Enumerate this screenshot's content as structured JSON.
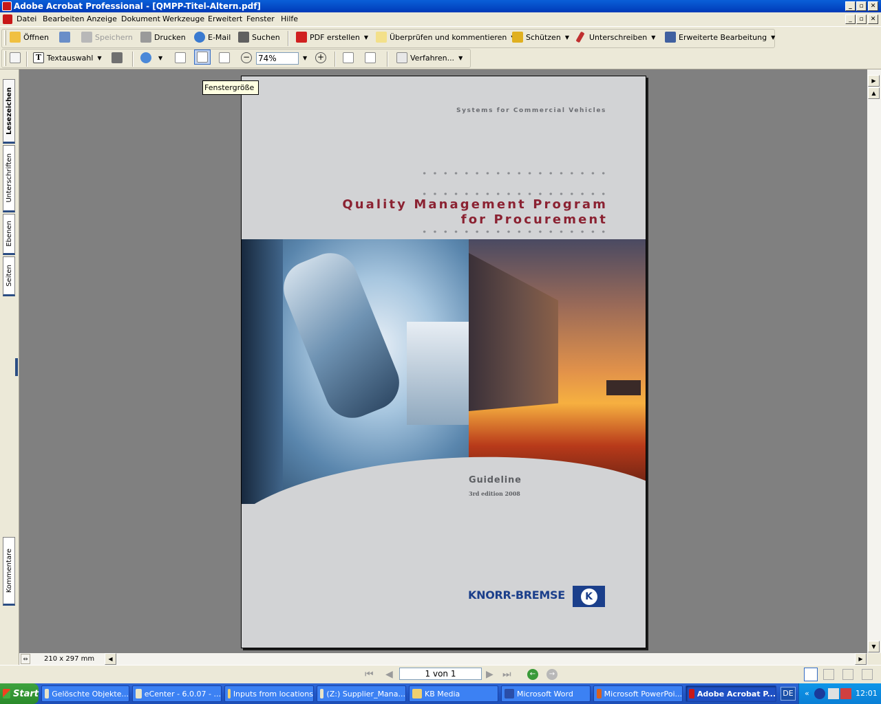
{
  "window": {
    "title": "Adobe Acrobat Professional - [QMPP-Titel-Altern.pdf]"
  },
  "menu": [
    "Datei",
    "Bearbeiten",
    "Anzeige",
    "Dokument",
    "Werkzeuge",
    "Erweitert",
    "Fenster",
    "Hilfe"
  ],
  "toolbar1": {
    "open": "Öffnen",
    "save": "Speichern",
    "print": "Drucken",
    "email": "E-Mail",
    "search": "Suchen",
    "create_pdf": "PDF erstellen",
    "review": "Überprüfen und kommentieren",
    "secure": "Schützen",
    "sign": "Unterschreiben",
    "advanced_edit": "Erweiterte Bearbeitung"
  },
  "toolbar2": {
    "text_select": "Textauswahl",
    "zoom": "74%",
    "procedures": "Verfahren..."
  },
  "tooltip": "Fenstergröße",
  "side_tabs": {
    "bookmarks": "Lesezeichen",
    "signatures": "Unterschriften",
    "layers": "Ebenen",
    "pages": "Seiten",
    "comments": "Kommentare"
  },
  "page_size": "210 x 297 mm",
  "page_indicator": "1 von 1",
  "document": {
    "tagline": "Systems for Commercial Vehicles",
    "title_line1": "Quality Management Program",
    "title_line2": "for Procurement",
    "subtitle": "Guideline",
    "edition": "3rd edition 2008",
    "brand": "KNORR-BREMSE",
    "brand_mark": "K"
  },
  "taskbar": {
    "start": "Start",
    "tasks": [
      "Gelöschte Objekte...",
      "eCenter - 6.0.07 - ...",
      "Inputs from locations",
      "(Z:) Supplier_Mana...",
      "KB Media",
      "Microsoft Word",
      "Microsoft PowerPoi...",
      "Adobe Acrobat P..."
    ],
    "language": "DE",
    "clock": "12:01"
  },
  "colors": {
    "title_red": "#8b2232",
    "brand_blue": "#1b3f8b",
    "xp_blue": "#0a5fd8"
  }
}
